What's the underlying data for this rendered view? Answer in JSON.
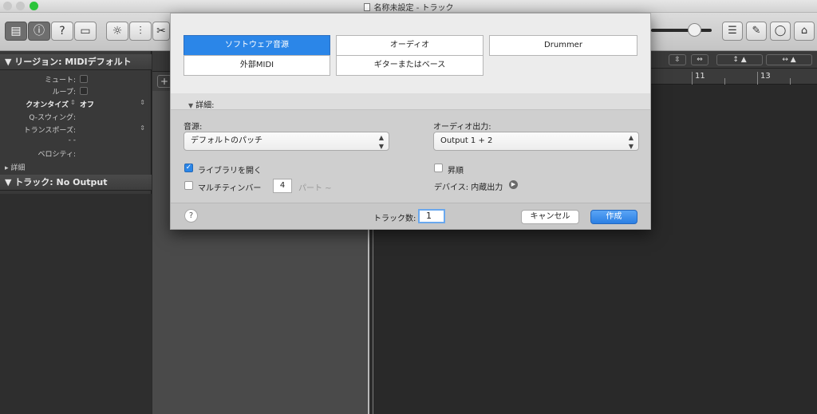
{
  "window": {
    "title": "名称未設定 - トラック"
  },
  "toolbar": {
    "left_icons": [
      "library-icon",
      "info-icon",
      "help-icon",
      "toolbar-icon",
      "smart-controls-icon",
      "mixer-icon",
      "scissors-icon"
    ],
    "right_icons": [
      "list-icon",
      "notepad-icon",
      "loop-browser-icon",
      "browser-icon"
    ]
  },
  "inspector": {
    "region_header": "リージョン: MIDIデフォルト",
    "rows": [
      {
        "label": "ミュート:",
        "kind": "checkbox"
      },
      {
        "label": "ループ:",
        "kind": "checkbox"
      },
      {
        "label": "クオンタイズ",
        "value": "オフ",
        "kind": "select"
      },
      {
        "label": "Q-スウィング:",
        "kind": "text"
      },
      {
        "label": "トランスポーズ:",
        "kind": "stepper"
      },
      {
        "label": "",
        "value": "- -",
        "kind": "text"
      },
      {
        "label": "ベロシティ:",
        "kind": "text"
      }
    ],
    "details_label": "詳細",
    "track_header": "トラック: No Output"
  },
  "ruler": {
    "marks": [
      "11",
      "13"
    ]
  },
  "dialog": {
    "track_types": [
      {
        "label": "ソフトウェア音源",
        "selected": true
      },
      {
        "label": "オーディオ",
        "selected": false
      },
      {
        "label": "Drummer",
        "selected": false
      },
      {
        "label": "外部MIDI",
        "selected": false
      },
      {
        "label": "ギターまたはベース",
        "selected": false
      }
    ],
    "details_header": "詳細:",
    "source_label": "音源:",
    "source_value": "デフォルトのパッチ",
    "output_label": "オーディオ出力:",
    "output_value": "Output 1 + 2",
    "open_library_label": "ライブラリを開く",
    "open_library_checked": true,
    "multitimbral_label": "マルチティンバー",
    "multitimbral_checked": false,
    "multitimbral_count": "4",
    "multitimbral_suffix": "パート",
    "ascending_label": "昇順",
    "ascending_checked": false,
    "device_label": "デバイス: 内蔵出力",
    "track_count_label": "トラック数:",
    "track_count_value": "1",
    "cancel_label": "キャンセル",
    "create_label": "作成",
    "colors": {
      "accent": "#2b86e8"
    }
  }
}
